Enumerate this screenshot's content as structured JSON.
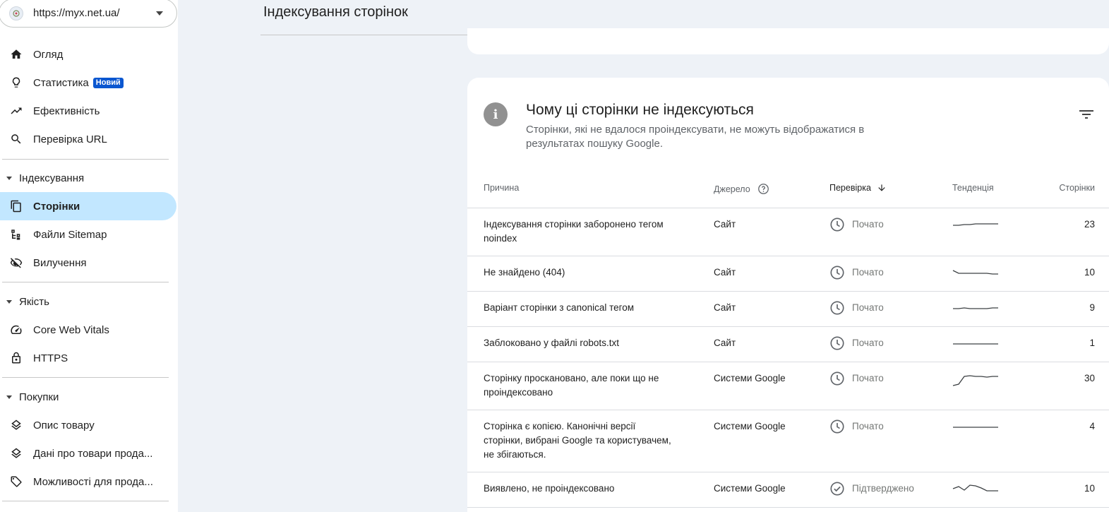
{
  "property": {
    "url": "https://myx.net.ua/"
  },
  "sidebar": {
    "items_top": [
      {
        "label": "Огляд",
        "icon": "home-icon"
      },
      {
        "label": "Статистика",
        "icon": "lightbulb-icon",
        "badge": "Новий"
      },
      {
        "label": "Ефективність",
        "icon": "trending-up-icon"
      },
      {
        "label": "Перевірка URL",
        "icon": "search-icon"
      }
    ],
    "sections": [
      {
        "title": "Індексування",
        "items": [
          {
            "label": "Сторінки",
            "icon": "pages-icon",
            "active": true
          },
          {
            "label": "Файли Sitemap",
            "icon": "sitemap-icon"
          },
          {
            "label": "Вилучення",
            "icon": "visibility-off-icon"
          }
        ]
      },
      {
        "title": "Якість",
        "items": [
          {
            "label": "Core Web Vitals",
            "icon": "speed-icon"
          },
          {
            "label": "HTTPS",
            "icon": "lock-icon"
          }
        ]
      },
      {
        "title": "Покупки",
        "items": [
          {
            "label": "Опис товару",
            "icon": "layers-icon"
          },
          {
            "label": "Дані про товари прода...",
            "icon": "layers-icon"
          },
          {
            "label": "Можливості для прода...",
            "icon": "tag-icon"
          }
        ]
      }
    ]
  },
  "header": {
    "title": "Індексування сторінок"
  },
  "card": {
    "title": "Чому ці сторінки не індексуються",
    "subtitle": "Сторінки, які не вдалося проіндексувати, не можуть відображатися в результатах пошуку Google.",
    "columns": {
      "reason": "Причина",
      "source": "Джерело",
      "validation": "Перевірка",
      "trend": "Тенденція",
      "pages": "Сторінки"
    },
    "rows": [
      {
        "reason": "Індексування сторінки заборонено тегом noindex",
        "source": "Сайт",
        "validation": "Почато",
        "status": "started",
        "pages": "23",
        "trend": [
          0.5,
          0.5,
          0.45,
          0.45,
          0.4,
          0.4,
          0.4,
          0.4,
          0.4
        ]
      },
      {
        "reason": "Не знайдено (404)",
        "source": "Сайт",
        "validation": "Почато",
        "status": "started",
        "pages": "10",
        "trend": [
          0.3,
          0.5,
          0.5,
          0.5,
          0.5,
          0.5,
          0.5,
          0.55,
          0.55
        ]
      },
      {
        "reason": "Варіант сторінки з canonical тегом",
        "source": "Сайт",
        "validation": "Почато",
        "status": "started",
        "pages": "9",
        "trend": [
          0.5,
          0.5,
          0.45,
          0.5,
          0.5,
          0.5,
          0.5,
          0.45,
          0.45
        ]
      },
      {
        "reason": "Заблоковано у файлі robots.txt",
        "source": "Сайт",
        "validation": "Почато",
        "status": "started",
        "pages": "1",
        "trend": [
          0.5,
          0.5,
          0.5,
          0.5,
          0.5,
          0.5,
          0.5,
          0.5,
          0.5
        ]
      },
      {
        "reason": "Сторінку проскановано, але поки що не проіндексовано",
        "source": "Системи Google",
        "validation": "Почато",
        "status": "started",
        "pages": "30",
        "trend": [
          0.95,
          0.85,
          0.3,
          0.25,
          0.3,
          0.3,
          0.35,
          0.3,
          0.3
        ]
      },
      {
        "reason": "Сторінка є копією. Канонічні версії сторінки, вибрані Google та користувачем, не збігаються.",
        "source": "Системи Google",
        "validation": "Почато",
        "status": "started",
        "pages": "4",
        "trend": [
          0.5,
          0.5,
          0.5,
          0.5,
          0.5,
          0.5,
          0.5,
          0.5,
          0.5
        ]
      },
      {
        "reason": "Виявлено, не проіндексовано",
        "source": "Системи Google",
        "validation": "Підтверджено",
        "status": "passed",
        "pages": "10",
        "trend": [
          0.45,
          0.3,
          0.55,
          0.2,
          0.25,
          0.4,
          0.6,
          0.6,
          0.6
        ]
      }
    ]
  }
}
